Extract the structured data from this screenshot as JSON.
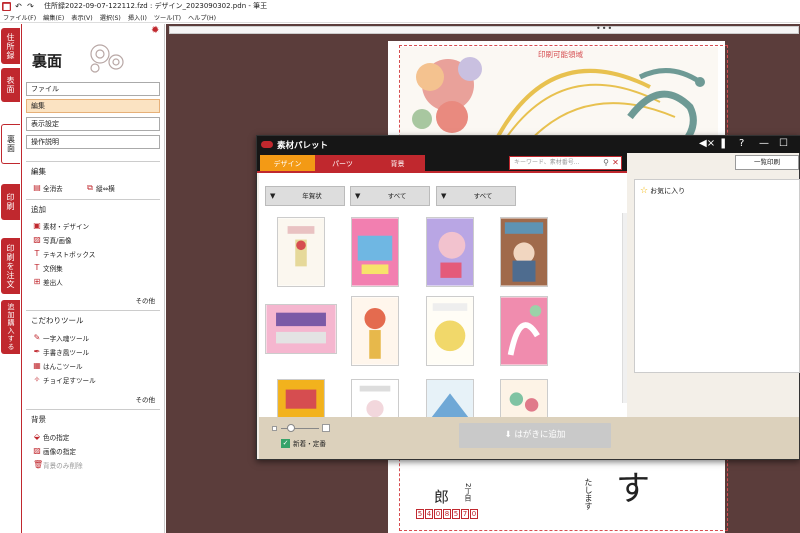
{
  "window": {
    "title": "住所録2022-09-07-122112.fzd : デザイン_2023090302.pdn - 筆王"
  },
  "menu": [
    "ファイル(F)",
    "編集(E)",
    "表示(V)",
    "選択(S)",
    "挿入(I)",
    "ツール(T)",
    "ヘルプ(H)"
  ],
  "vtabs": [
    "住所録",
    "表面",
    "裏面",
    "印刷",
    "印刷を注文",
    "追加購入する"
  ],
  "side": {
    "heading": "裏面",
    "nav": [
      "ファイル",
      "編集",
      "表示設定",
      "操作説明"
    ],
    "edit": {
      "title": "編集",
      "items": [
        "全消去",
        "縦⇔横"
      ]
    },
    "add": {
      "title": "追加",
      "items": [
        "素材・デザイン",
        "写真/画像",
        "テキストボックス",
        "文例集",
        "差出人"
      ],
      "more": "その他"
    },
    "tools": {
      "title": "こだわりツール",
      "items": [
        "一字入魂ツール",
        "手書き風ツール",
        "はんこツール",
        "チョイ足すツール"
      ],
      "more": "その他"
    },
    "bg": {
      "title": "背景",
      "items": [
        "色の指定",
        "画像の指定",
        "背景のみ削除"
      ]
    }
  },
  "card": {
    "printable": "印刷可能領域",
    "name": "郎",
    "addr": "2丁目",
    "postal": [
      "5",
      "4",
      "0",
      "8",
      "5",
      "7",
      "0"
    ],
    "masu": "たします",
    "big": "す"
  },
  "dialog": {
    "title": "素材パレット",
    "tabs": [
      "デザイン",
      "パーツ",
      "背景"
    ],
    "search_placeholder": "キーワード、素材番号...",
    "print_label": "一覧印刷",
    "dropdowns": [
      "年賀状",
      "すべて",
      "すべて"
    ],
    "favorites": "お気に入り",
    "checkbox_label": "新着・定番",
    "add_button": "はがきに追加"
  },
  "colors": {
    "brand_red": "#c0282e",
    "tab_active": "#f39a15",
    "canvas": "#5b3d3b",
    "dialog_footer": "#dcd1bc"
  }
}
